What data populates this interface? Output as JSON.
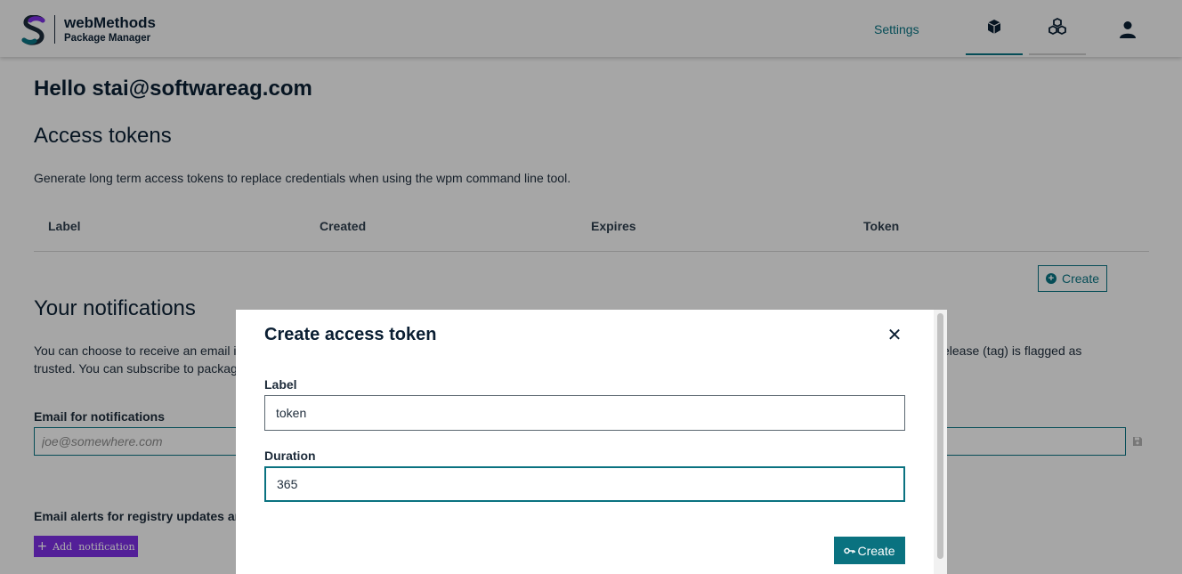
{
  "header": {
    "brand_title": "webMethods",
    "brand_subtitle": "Package Manager",
    "nav": {
      "settings_label": "Settings",
      "packages_icon": "cube-icon",
      "registries_icon": "cubes-icon",
      "user_icon": "user-icon"
    },
    "colors": {
      "accent": "#0a7280",
      "brand_purple": "#7b2ee0"
    }
  },
  "main": {
    "greeting": "Hello stai@softwareag.com",
    "access_tokens": {
      "heading": "Access tokens",
      "description": "Generate long term access tokens to replace credentials when using the wpm command line tool.",
      "columns": [
        "Label",
        "Created",
        "Expires",
        "Token"
      ],
      "create_label": "Create"
    },
    "notifications": {
      "heading": "Your notifications",
      "description_left": "You can choose to receive an email i",
      "description_right": "elease (tag) is flagged as",
      "description_line2": "trusted. You can subscribe to packag",
      "email_label": "Email for notifications",
      "email_placeholder": "joe@somewhere.com",
      "alerts_heading": "Email alerts for registry updates and",
      "add_notification_label": "Add  notification"
    }
  },
  "modal": {
    "title": "Create access token",
    "close_icon": "close-icon",
    "label_field": {
      "label": "Label",
      "value": "token"
    },
    "duration_field": {
      "label": "Duration",
      "value": "365"
    },
    "create_label": "Create",
    "create_icon": "key-icon"
  }
}
